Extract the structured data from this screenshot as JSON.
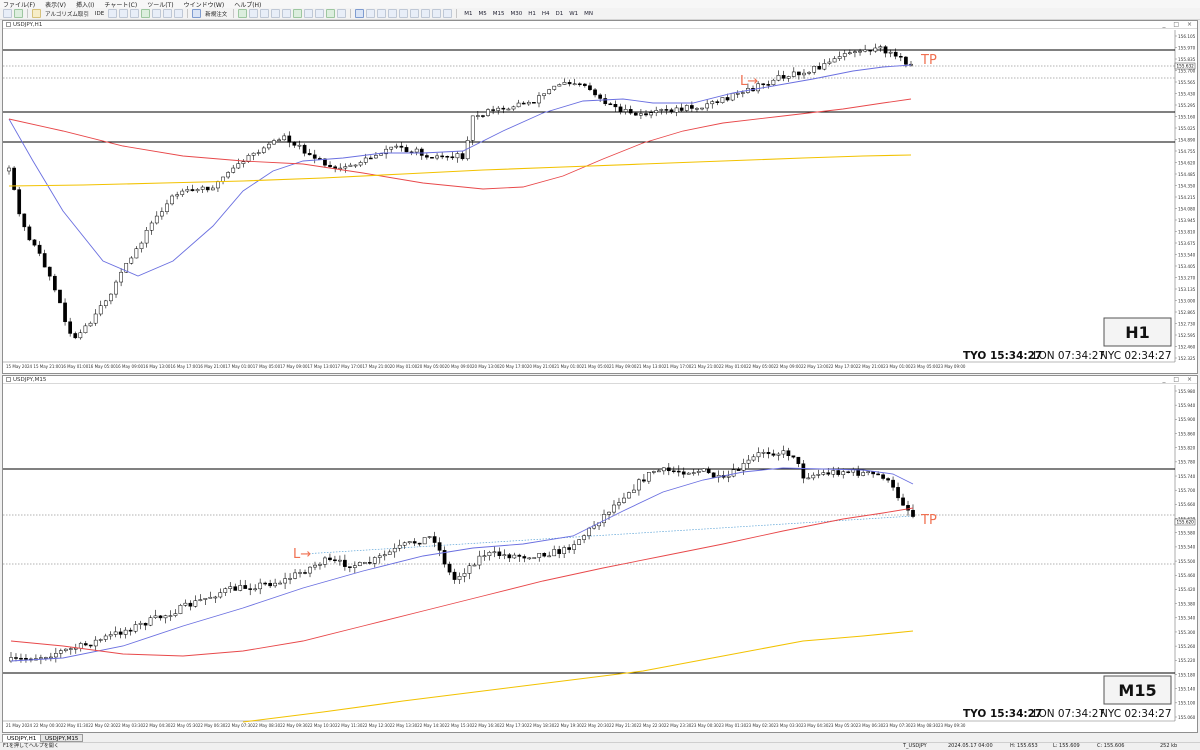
{
  "menu": [
    "ファイル(F)",
    "表示(V)",
    "挿入(I)",
    "チャート(C)",
    "ツール(T)",
    "ウインドウ(W)",
    "ヘルプ(H)"
  ],
  "toolbar": {
    "algo_label": "アルゴリズム取引",
    "new_order_label": "新規注文",
    "ide_label": "IDE",
    "timeframes": [
      "M1",
      "M5",
      "M15",
      "M30",
      "H1",
      "H4",
      "D1",
      "W1",
      "MN"
    ]
  },
  "charts": [
    {
      "id": "h1",
      "window_title": "USDJPY,H1",
      "tf_label": "H1",
      "clock": {
        "tyo": "TYO 15:34:27",
        "lon": "LON 07:34:27",
        "nyc": "NYC 02:34:27"
      },
      "tp_label": "TP",
      "l_label": "L→",
      "price_labels": [
        "156.105",
        "155.970",
        "155.835",
        "155.700",
        "155.565",
        "155.430",
        "155.295",
        "155.160",
        "155.025",
        "154.890",
        "154.755",
        "154.620",
        "154.485",
        "154.350",
        "154.215",
        "154.080",
        "153.945",
        "153.810",
        "153.675",
        "153.540",
        "153.405",
        "153.270",
        "153.135",
        "153.000",
        "152.865",
        "152.730",
        "152.595",
        "152.460",
        "152.325"
      ],
      "time_labels": [
        "15 May 2024",
        "15 May 21:00",
        "16 May 01:00",
        "16 May 05:00",
        "16 May 09:00",
        "16 May 13:00",
        "16 May 17:00",
        "16 May 21:00",
        "17 May 01:00",
        "17 May 05:00",
        "17 May 09:00",
        "17 May 13:00",
        "17 May 17:00",
        "17 May 21:00",
        "20 May 01:00",
        "20 May 05:00",
        "20 May 09:00",
        "20 May 13:00",
        "20 May 17:00",
        "20 May 21:00",
        "21 May 01:00",
        "21 May 05:00",
        "21 May 09:00",
        "21 May 13:00",
        "21 May 17:00",
        "21 May 21:00",
        "22 May 01:00",
        "22 May 05:00",
        "22 May 09:00",
        "22 May 13:00",
        "22 May 17:00",
        "22 May 21:00",
        "23 May 01:00",
        "23 May 05:00",
        "23 May 09:00"
      ],
      "current_price_box": "155.632"
    },
    {
      "id": "m15",
      "window_title": "USDJPY,M15",
      "tf_label": "M15",
      "clock": {
        "tyo": "TYO 15:34:27",
        "lon": "LON 07:34:27",
        "nyc": "NYC 02:34:27"
      },
      "tp_label": "TP",
      "l_label": "L→",
      "price_labels": [
        "155.980",
        "155.940",
        "155.900",
        "155.860",
        "155.820",
        "155.780",
        "155.740",
        "155.700",
        "155.660",
        "155.620",
        "155.580",
        "155.540",
        "155.500",
        "155.460",
        "155.420",
        "155.380",
        "155.340",
        "155.300",
        "155.260",
        "155.220",
        "155.180",
        "155.140",
        "155.100",
        "155.060"
      ],
      "time_labels": [
        "21 May 2024",
        "22 May 00:30",
        "22 May 01:30",
        "22 May 02:30",
        "22 May 03:30",
        "22 May 04:30",
        "22 May 05:30",
        "22 May 06:30",
        "22 May 07:30",
        "22 May 08:30",
        "22 May 09:30",
        "22 May 10:30",
        "22 May 11:30",
        "22 May 12:30",
        "22 May 13:30",
        "22 May 14:30",
        "22 May 15:30",
        "22 May 16:30",
        "22 May 17:30",
        "22 May 18:30",
        "22 May 19:30",
        "22 May 20:30",
        "22 May 21:30",
        "22 May 22:30",
        "22 May 23:30",
        "23 May 00:30",
        "23 May 01:30",
        "23 May 02:30",
        "23 May 03:30",
        "23 May 04:30",
        "23 May 05:30",
        "23 May 06:30",
        "23 May 07:30",
        "23 May 08:30",
        "23 May 09:30"
      ],
      "current_price_box": "155.620"
    }
  ],
  "tabs": [
    "USDJPY,H1",
    "USDJPY,M15"
  ],
  "status": {
    "help": "F1を押してヘルプを開く",
    "symbol": "T_USDJPY",
    "datetime": "2024.05.17 04:00",
    "high": "H: 155.653",
    "low": "L: 155.609",
    "close": "C: 155.606",
    "traffic": "252 kb"
  },
  "colors": {
    "ma_blue": "#6a6fe0",
    "ma_red": "#e8484a",
    "ma_yellow": "#f2c200",
    "tp_text": "#f07050",
    "level_dash_blue": "#5aa2d6"
  },
  "chart_data": [
    {
      "type": "candlestick",
      "title": "USDJPY,H1",
      "ylim": [
        152.3,
        156.2
      ],
      "ohlc_shape": "approximated from screenshot — rally from ~153.3 low to ~156.0",
      "horizontal_levels": [
        155.94,
        155.48,
        155.08,
        154.8
      ],
      "dotted_levels": [
        155.72,
        155.62
      ],
      "ma_series": [
        "blue",
        "red",
        "yellow"
      ]
    },
    {
      "type": "candlestick",
      "title": "USDJPY,M15",
      "ylim": [
        155.04,
        156.0
      ],
      "horizontal_levels": [
        155.74,
        155.11
      ],
      "dotted_levels": [
        155.63,
        155.47
      ],
      "ma_series": [
        "blue",
        "red",
        "yellow"
      ]
    }
  ]
}
